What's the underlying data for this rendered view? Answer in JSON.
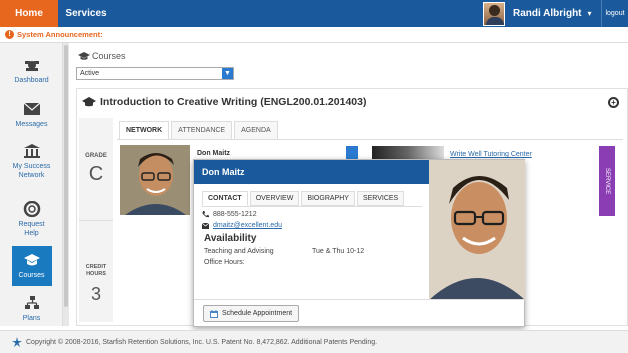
{
  "topbar": {
    "home_label": "Home",
    "services_label": "Services",
    "user_name": "Randi Albright",
    "user_caret": "▾",
    "logout_label": "logout"
  },
  "announcement": {
    "icon": "!",
    "text": "System Announcement:"
  },
  "nav": {
    "items": [
      {
        "label": "Dashboard",
        "icon": "dashboard-icon"
      },
      {
        "label": "Messages",
        "icon": "envelope-icon"
      },
      {
        "label": "My Success Network",
        "icon": "building-icon"
      },
      {
        "label": "Request Help",
        "icon": "lifebuoy-icon"
      },
      {
        "label": "Courses",
        "icon": "graduation-cap-icon",
        "active": true
      },
      {
        "label": "Plans",
        "icon": "sitemap-icon"
      }
    ]
  },
  "main": {
    "breadcrumb": "Courses",
    "filter_value": "Active",
    "course_title": "Introduction to Creative Writing (ENGL200.01.201403)",
    "grade_label": "GRADE",
    "grade_value": "C",
    "credit_label": "CREDIT HOURS",
    "credit_value": "3",
    "tabs": [
      "NETWORK",
      "ATTENDANCE",
      "AGENDA"
    ],
    "card_name": "Don Maitz",
    "card2_link": "Write Well Tutoring Center",
    "service_tab": "SERVICE"
  },
  "popup": {
    "name": "Don Maitz",
    "tabs": [
      "CONTACT",
      "OVERVIEW",
      "BIOGRAPHY",
      "SERVICES"
    ],
    "phone": "888-555-1212",
    "email": "dmaitz@excellent.edu",
    "availability_title": "Availability",
    "availability_label": "Teaching and Advising",
    "availability_value": "Tue & Thu 10-12",
    "office_hours_label": "Office Hours:",
    "schedule_button": "Schedule Appointment"
  },
  "footer": {
    "text": "Copyright © 2008-2016, Starfish Retention Solutions, Inc. U.S. Patent No. 8,472,862. Additional Patents Pending."
  },
  "colors": {
    "brand_blue": "#1a5a9c",
    "accent_orange": "#e8671f",
    "service_purple": "#8b3db3"
  }
}
